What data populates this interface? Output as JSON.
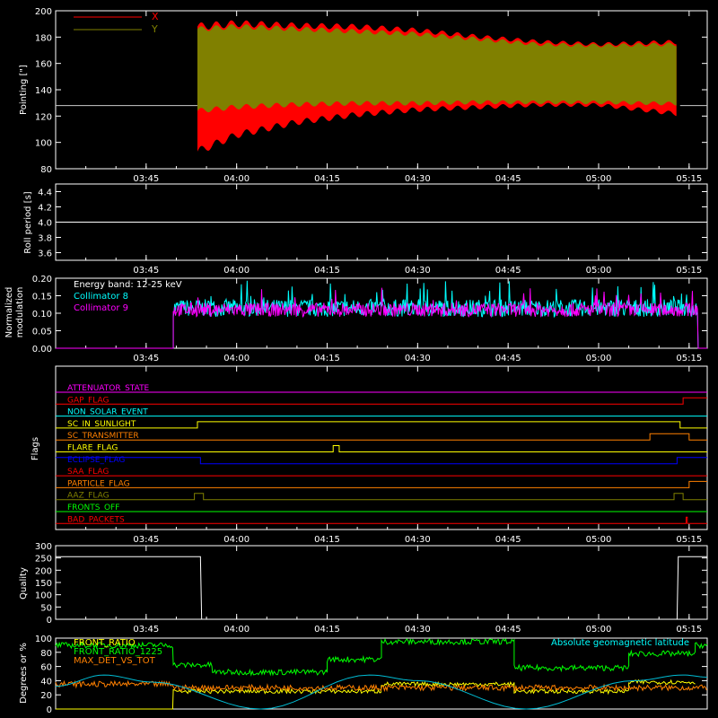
{
  "time_axis": {
    "ticks": [
      "03:45",
      "04:00",
      "04:15",
      "04:30",
      "04:45",
      "05:00",
      "05:15"
    ],
    "tick_values_min": [
      225,
      240,
      255,
      270,
      285,
      300,
      315
    ],
    "range_min": [
      210,
      318
    ],
    "unit": "minutes since 00:00"
  },
  "chart_data": [
    {
      "id": "pointing",
      "type": "line",
      "ylabel": "Pointing [\"]",
      "ylim": [
        80,
        200
      ],
      "yticks": [
        80,
        100,
        120,
        140,
        160,
        180,
        200
      ],
      "reference_line": 128,
      "legend_placement": "top-left",
      "data_start_min": 233.5,
      "data_end_min": 313.5,
      "series": [
        {
          "name": "X",
          "color": "#ff0000",
          "x": [
            233.5,
            240,
            250,
            260,
            270,
            280,
            290,
            300,
            313
          ],
          "min": [
            90,
            103,
            113,
            119,
            123,
            125,
            127,
            127,
            120
          ],
          "max": [
            191,
            193,
            191,
            190,
            187,
            182,
            178,
            176,
            178
          ]
        },
        {
          "name": "Y",
          "color": "#808000",
          "x": [
            233.5,
            240,
            250,
            260,
            270,
            280,
            290,
            300,
            313
          ],
          "min": [
            122,
            125,
            127,
            128,
            128,
            129,
            129,
            129,
            128
          ],
          "max": [
            188,
            190,
            188,
            186,
            184,
            180,
            176,
            175,
            176
          ]
        }
      ]
    },
    {
      "id": "roll",
      "type": "line",
      "ylabel": "Roll period [s]",
      "ylim": [
        3.5,
        4.5
      ],
      "yticks": [
        "3.6",
        "3.8",
        "4.0",
        "4.2",
        "4.4"
      ],
      "series": [
        {
          "name": "",
          "color": "#ffffff",
          "x": [
            210,
            318
          ],
          "y": [
            4.0,
            4.0
          ]
        }
      ]
    },
    {
      "id": "modulation",
      "type": "line",
      "ylabel": "Normalized modulation",
      "ylabel_lines": [
        "Normalized",
        "modulation"
      ],
      "ylim": [
        0,
        0.2
      ],
      "yticks": [
        "0.00",
        "0.05",
        "0.10",
        "0.15",
        "0.20"
      ],
      "annotation": "Energy band: 12-25 keV",
      "data_start_min": 229.5,
      "data_end_min": 316.5,
      "series": [
        {
          "name": "Collimator 8",
          "color": "#00ffff",
          "mean": 0.115,
          "spread": 0.025
        },
        {
          "name": "Collimator 9",
          "color": "#ff00ff",
          "mean": 0.11,
          "spread": 0.02
        }
      ]
    },
    {
      "id": "flags",
      "type": "line",
      "ylabel": "Flags",
      "series": [
        {
          "name": "ATTENUATOR_STATE",
          "color": "#ff00ff",
          "segments": [
            [
              210,
              318,
              0
            ]
          ]
        },
        {
          "name": "GAP_FLAG",
          "color": "#ff0000",
          "segments": [
            [
              210,
              314,
              0
            ],
            [
              314,
              318,
              1
            ]
          ]
        },
        {
          "name": "NON_SOLAR_EVENT",
          "color": "#00ffff",
          "segments": [
            [
              210,
              318,
              0
            ]
          ]
        },
        {
          "name": "SC_IN_SUNLIGHT",
          "color": "#ffff00",
          "segments": [
            [
              210,
              233.5,
              0
            ],
            [
              233.5,
              313.5,
              1
            ],
            [
              313.5,
              318,
              0
            ]
          ]
        },
        {
          "name": "SC_TRANSMITTER",
          "color": "#ff8000",
          "segments": [
            [
              210,
              308.5,
              0
            ],
            [
              308.5,
              315,
              1
            ],
            [
              315,
              318,
              0
            ]
          ]
        },
        {
          "name": "FLARE_FLAG",
          "color": "#ffff00",
          "segments": [
            [
              210,
              256,
              0
            ],
            [
              256,
              257,
              1
            ],
            [
              257,
              318,
              0
            ]
          ]
        },
        {
          "name": "ECLIPSE_FLAG",
          "color": "#0000ff",
          "segments": [
            [
              210,
              234,
              1
            ],
            [
              234,
              313,
              0
            ],
            [
              313,
              318,
              1
            ]
          ]
        },
        {
          "name": "SAA_FLAG",
          "color": "#ff0000",
          "segments": [
            [
              210,
              318,
              0
            ]
          ]
        },
        {
          "name": "PARTICLE_FLAG",
          "color": "#ff8000",
          "segments": [
            [
              210,
              315,
              0
            ],
            [
              315,
              318,
              1
            ]
          ]
        },
        {
          "name": "AAZ_FLAG",
          "color": "#808000",
          "segments": [
            [
              210,
              233,
              0
            ],
            [
              233,
              234.5,
              1
            ],
            [
              234.5,
              312.5,
              0
            ],
            [
              312.5,
              314,
              1
            ],
            [
              314,
              318,
              0
            ]
          ]
        },
        {
          "name": "FRONTS_OFF",
          "color": "#00ff00",
          "segments": [
            [
              210,
              318,
              0
            ]
          ]
        },
        {
          "name": "BAD_PACKETS",
          "color": "#ff0000",
          "segments": [
            [
              210,
              314.5,
              0
            ],
            [
              314.5,
              314.7,
              1
            ],
            [
              314.7,
              318,
              0
            ]
          ]
        }
      ]
    },
    {
      "id": "quality",
      "type": "line",
      "ylabel": "Quality",
      "ylim": [
        0,
        300
      ],
      "yticks": [
        0,
        50,
        100,
        150,
        200,
        250,
        300
      ],
      "series": [
        {
          "name": "",
          "color": "#ffffff",
          "x": [
            210,
            234,
            234.2,
            313,
            313.2,
            318
          ],
          "y": [
            255,
            255,
            0,
            0,
            255,
            255
          ]
        }
      ]
    },
    {
      "id": "ratios",
      "type": "line",
      "ylabel": "Degrees or %",
      "ylim": [
        0,
        100
      ],
      "yticks": [
        0,
        20,
        40,
        60,
        80,
        100
      ],
      "annotation": "Absolute geomagnetic latitude",
      "series": [
        {
          "name": "FRONT_RATIO",
          "color": "#00ff00",
          "levels": [
            [
              210,
              229.5,
              90
            ],
            [
              229.5,
              236,
              62
            ],
            [
              236,
              255,
              52
            ],
            [
              255,
              264,
              70
            ],
            [
              264,
              286,
              95
            ],
            [
              286,
              305,
              58
            ],
            [
              305,
              316,
              78
            ],
            [
              316,
              318,
              90
            ]
          ]
        },
        {
          "name": "FRONT_RATIO_1225",
          "color": "#ffff00",
          "levels": [
            [
              210,
              229.5,
              0
            ],
            [
              229.5,
              264,
              25
            ],
            [
              264,
              286,
              35
            ],
            [
              286,
              305,
              25
            ],
            [
              305,
              316,
              38
            ]
          ]
        },
        {
          "name": "MAX_DET_VS_TOT",
          "color": "#ff8000",
          "levels": [
            [
              210,
              229.5,
              35
            ],
            [
              229.5,
              318,
              30
            ]
          ]
        },
        {
          "name": "",
          "color": "#00bcd4",
          "x": [
            210,
            218,
            226,
            244,
            262,
            270,
            288,
            306,
            314,
            318
          ],
          "y": [
            32,
            48,
            38,
            0,
            48,
            40,
            0,
            40,
            48,
            45
          ]
        }
      ]
    }
  ]
}
